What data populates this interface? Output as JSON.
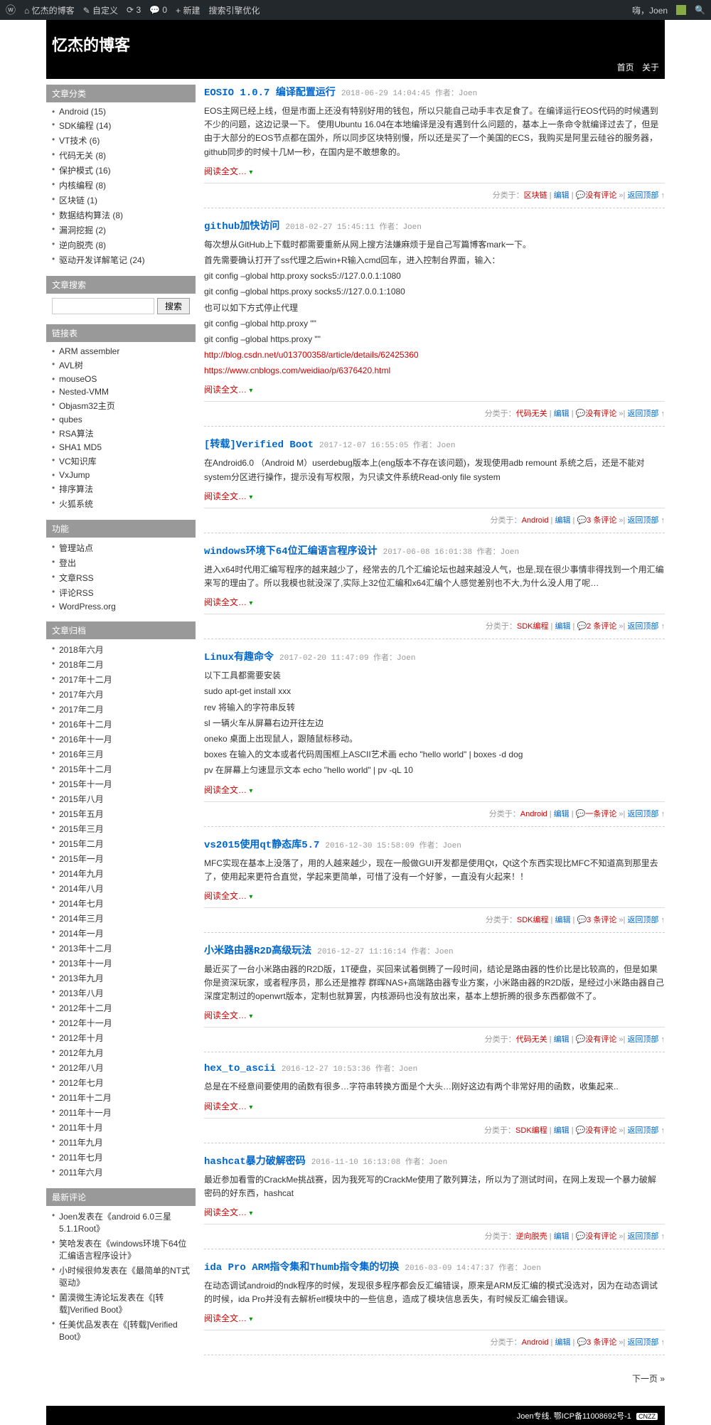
{
  "adminbar": {
    "site": "忆杰的博客",
    "customize": "自定义",
    "updates": "3",
    "comments": "0",
    "new": "新建",
    "seo": "搜索引擎优化",
    "hi": "嗨，Joen"
  },
  "header": {
    "title": "忆杰的博客",
    "nav": [
      "首页",
      "关于"
    ]
  },
  "widgets": {
    "cat_title": "文章分类",
    "cats": [
      "Android (15)",
      "SDK编程 (14)",
      "VT技术 (6)",
      "代码无关 (8)",
      "保护模式 (16)",
      "内核编程 (8)",
      "区块链 (1)",
      "数据结构算法 (8)",
      "漏洞挖掘 (2)",
      "逆向脱壳 (8)",
      "驱动开发详解笔记 (24)"
    ],
    "search_title": "文章搜索",
    "search_btn": "搜索",
    "links_title": "链接表",
    "links": [
      "ARM assembler",
      "AVL树",
      "mouseOS",
      "Nested-VMM",
      "Objasm32主页",
      "qubes",
      "RSA算法",
      "SHA1 MD5",
      "VC知识库",
      "VxJump",
      "排序算法",
      "火狐系统"
    ],
    "func_title": "功能",
    "funcs": [
      "管理站点",
      "登出",
      "文章RSS",
      "评论RSS",
      "WordPress.org"
    ],
    "arch_title": "文章归档",
    "archs": [
      "2018年六月",
      "2018年二月",
      "2017年十二月",
      "2017年六月",
      "2017年二月",
      "2016年十二月",
      "2016年十一月",
      "2016年三月",
      "2015年十二月",
      "2015年十一月",
      "2015年八月",
      "2015年五月",
      "2015年三月",
      "2015年二月",
      "2015年一月",
      "2014年九月",
      "2014年八月",
      "2014年七月",
      "2014年三月",
      "2014年一月",
      "2013年十二月",
      "2013年十一月",
      "2013年九月",
      "2013年八月",
      "2012年十二月",
      "2012年十一月",
      "2012年十月",
      "2012年九月",
      "2012年八月",
      "2012年七月",
      "2011年十二月",
      "2011年十一月",
      "2011年十月",
      "2011年九月",
      "2011年七月",
      "2011年六月"
    ],
    "recent_title": "最新评论",
    "recent": [
      "Joen发表在《android 6.0三星5.1.1Root》",
      "笑哈发表在《windows环境下64位汇编语言程序设计》",
      "小时候很帅发表在《最简单的NT式驱动》",
      "菌漠微生涛论坛发表在《[转载]Verified Boot》",
      "任美优品发表在《[转载]Verified Boot》"
    ]
  },
  "posts": [
    {
      "title": "EOSIO 1.0.7 编译配置运行",
      "date": "2018-06-29 14:04:45",
      "author": "作者：Joen",
      "body": [
        "EOS主网已经上线，但是市面上还没有特别好用的钱包，所以只能自己动手丰衣足食了。在编译运行EOS代码的时候遇到不少的问题，这边记录一下。 使用Ubuntu 16.04在本地编译是没有遇到什么问题的，基本上一条命令就编译过去了，但是由于大部分的EOS节点都在国外，所以同步区块特别慢，所以还是买了一个美国的ECS，我购买是阿里云硅谷的服务器，github同步的时候十几M一秒，在国内是不敢想象的。"
      ],
      "cat": "区块链",
      "comm": "没有评论"
    },
    {
      "title": "github加快访问",
      "date": "2018-02-27 15:45:11",
      "author": "作者：Joen",
      "body": [
        "每次想从GitHub上下载时都需要重新从网上搜方法嫌麻烦于是自己写篇博客mark一下。",
        "首先需要确认打开了ss代理之后win+R输入cmd回车，进入控制台界面，输入：",
        "git config –global http.proxy socks5://127.0.0.1:1080",
        "git config –global https.proxy socks5://127.0.0.1:1080",
        "也可以如下方式停止代理",
        "git config –global http.proxy \"\"",
        "git config –global https.proxy \"\""
      ],
      "links": [
        "http://blog.csdn.net/u013700358/article/details/62425360",
        "https://www.cnblogs.com/weidiao/p/6376420.html"
      ],
      "cat": "代码无关",
      "comm": "没有评论"
    },
    {
      "title": "[转载]Verified Boot",
      "date": "2017-12-07 16:55:05",
      "author": "作者：Joen",
      "body": [
        "在Android6.0 （Android M）userdebug版本上(eng版本不存在该问题)，发现使用adb remount 系统之后，还是不能对system分区进行操作，提示没有写权限，为只读文件系统Read-only file system"
      ],
      "cat": "Android",
      "comm": "3 条评论"
    },
    {
      "title": "windows环境下64位汇编语言程序设计",
      "date": "2017-06-08 16:01:38",
      "author": "作者：Joen",
      "body": [
        "进入x64时代用汇编写程序的越来越少了，经常去的几个汇编论坛也越来越没人气，也是,现在很少事情非得找到一个用汇编来写的理由了。所以我模也就没深了,实际上32位汇编和x64汇编个人感觉差别也不大,为什么没人用了呢…"
      ],
      "cat": "SDK编程",
      "comm": "2 条评论"
    },
    {
      "title": "Linux有趣命令",
      "date": "2017-02-20 11:47:09",
      "author": "作者：Joen",
      "body": [
        "以下工具都需要安装",
        "sudo apt-get install xxx",
        "rev 将输入的字符串反转",
        "sl 一辆火车从屏幕右边开往左边",
        "oneko 桌面上出现鼠人，跟随鼠标移动。",
        "boxes 在输入的文本或者代码周围框上ASCII艺术画 echo \"hello world\" | boxes -d dog",
        "pv 在屏幕上匀速显示文本 echo \"hello world\" | pv -qL 10"
      ],
      "cat": "Android",
      "comm": "一条评论"
    },
    {
      "title": "vs2015使用qt静态库5.7",
      "date": "2016-12-30 15:58:09",
      "author": "作者：Joen",
      "body": [
        "MFC实现在基本上没落了，用的人越来越少，现在一般做GUI开发都是使用Qt，Qt这个东西实现比MFC不知道高到那里去了，使用起来更符合直觉，学起来更简单，可惜了没有一个好爹，一直没有火起来！！"
      ],
      "cat": "SDK编程",
      "comm": "3 条评论"
    },
    {
      "title": "小米路由器R2D高级玩法",
      "date": "2016-12-27 11:16:14",
      "author": "作者：Joen",
      "body": [
        "最近买了一台小米路由器的R2D版，1T硬盘，买回来试着倒腾了一段时间，结论是路由器的性价比是比较高的，但是如果你是资深玩家，或者程序员，那么还是推荐 群晖NAS+高端路由器专业方案，小米路由器的R2D版，是经过小米路由器自己深度定制过的openwrt版本，定制也就算罢，内核源码也没有放出来，基本上想折腾的很多东西都做不了。"
      ],
      "cat": "代码无关",
      "comm": "没有评论"
    },
    {
      "title": "hex_to_ascii",
      "date": "2016-12-27 10:53:36",
      "author": "作者：Joen",
      "body": [
        "总是在不经意间要使用的函数有很多…字符串转换方面是个大头…刚好这边有两个非常好用的函数，收集起来.."
      ],
      "cat": "SDK编程",
      "comm": "没有评论"
    },
    {
      "title": "hashcat暴力破解密码",
      "date": "2016-11-10 16:13:08",
      "author": "作者：Joen",
      "body": [
        "最近参加看雪的CrackMe挑战赛，因为我死写的CrackMe使用了散列算法，所以为了测试时间，在网上发现一个暴力破解密码的好东西，hashcat"
      ],
      "cat": "逆向脱壳",
      "comm": "没有评论"
    },
    {
      "title": "ida Pro ARM指令集和Thumb指令集的切换",
      "date": "2016-03-09 14:47:37",
      "author": "作者：Joen",
      "body": [
        "在动态调试android的ndk程序的时候，发现很多程序都会反汇编错误，原来是ARM反汇编的模式没选对，因为在动态调试的时候，ida Pro并没有去解析elf模块中的一些信息，造成了模块信息丢失，有时候反汇编会错误。"
      ],
      "cat": "Android",
      "comm": "3 条评论"
    }
  ],
  "read_more": "阅读全文…",
  "cat_prefix": "分类于：",
  "edit": "编辑",
  "top": "返回顶部",
  "pager": "下一页 »",
  "footer": {
    "a": "Joen专线",
    "b": "鄂ICP备11008692号-1",
    "c": "CNZZ"
  }
}
